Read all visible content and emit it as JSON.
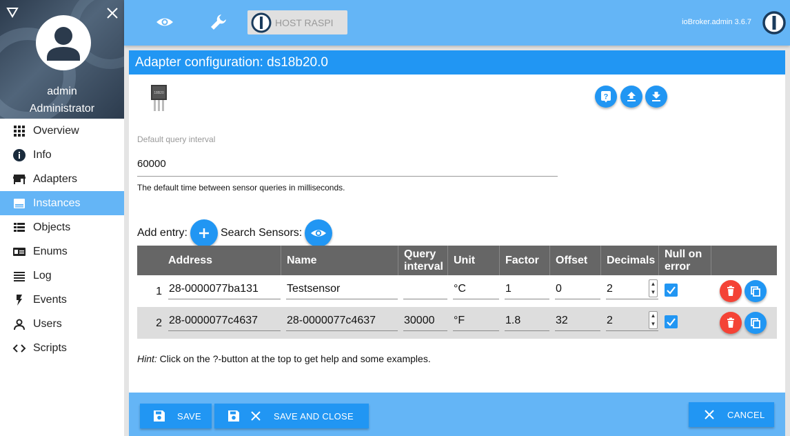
{
  "sidebar": {
    "user_name": "admin",
    "user_role": "Administrator",
    "items": [
      {
        "label": "Overview",
        "icon": "grid-icon"
      },
      {
        "label": "Info",
        "icon": "info-icon"
      },
      {
        "label": "Adapters",
        "icon": "store-icon"
      },
      {
        "label": "Instances",
        "icon": "instances-icon",
        "active": true
      },
      {
        "label": "Objects",
        "icon": "list-icon"
      },
      {
        "label": "Enums",
        "icon": "enum-icon"
      },
      {
        "label": "Log",
        "icon": "log-icon"
      },
      {
        "label": "Events",
        "icon": "flash-icon"
      },
      {
        "label": "Users",
        "icon": "person-icon"
      },
      {
        "label": "Scripts",
        "icon": "code-icon"
      }
    ]
  },
  "topbar": {
    "host_label": "HOST RASPI",
    "version": "ioBroker.admin 3.6.7"
  },
  "config": {
    "title": "Adapter configuration: ds18b20.0",
    "query_interval_label": "Default query interval",
    "query_interval_value": "60000",
    "query_interval_help": "The default time between sensor queries in milliseconds.",
    "add_entry_label": "Add entry:",
    "search_sensors_label": "Search Sensors:"
  },
  "table": {
    "headers": {
      "address": "Address",
      "name": "Name",
      "query_interval_l1": "Query",
      "query_interval_l2": "interval",
      "unit": "Unit",
      "factor": "Factor",
      "offset": "Offset",
      "decimals": "Decimals",
      "null_l1": "Null on",
      "null_l2": "error"
    },
    "rows": [
      {
        "num": "1",
        "address": "28-0000077ba131",
        "name": "Testsensor",
        "interval": "",
        "unit": "°C",
        "factor": "1",
        "offset": "0",
        "decimals": "2",
        "null_on_error": true
      },
      {
        "num": "2",
        "address": "28-0000077c4637",
        "name": "28-0000077c4637",
        "interval": "30000",
        "unit": "°F",
        "factor": "1.8",
        "offset": "32",
        "decimals": "2",
        "null_on_error": true
      }
    ]
  },
  "hint": {
    "prefix": "Hint:",
    "text": " Click on the ?-button at the top to get help and some examples."
  },
  "bottombar": {
    "save": "SAVE",
    "save_close": "SAVE AND CLOSE",
    "cancel": "CANCEL"
  },
  "colors": {
    "primary": "#2196f3",
    "primary_light": "#64b5f6",
    "danger": "#f44336",
    "header_gray": "#666666"
  }
}
